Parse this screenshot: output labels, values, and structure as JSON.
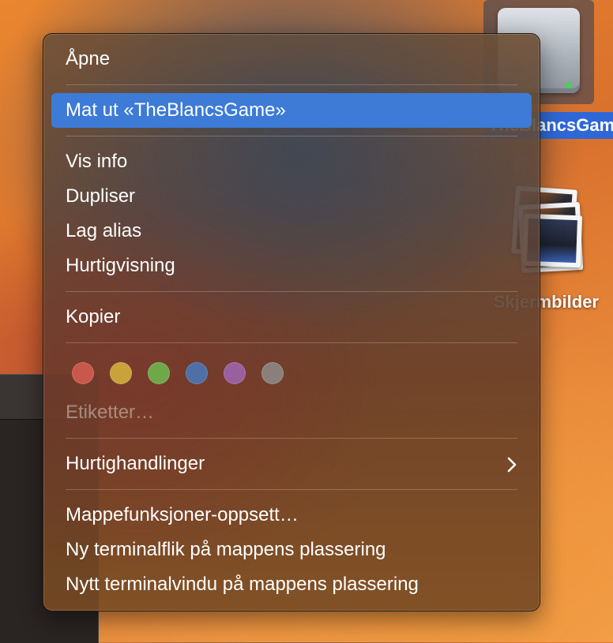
{
  "desktop": {
    "drive_label": "TheBlancsGame",
    "photos_label": "Skjermbilder"
  },
  "menu": {
    "open": "Åpne",
    "eject": "Mat ut «TheBlancsGame»",
    "get_info": "Vis info",
    "duplicate": "Dupliser",
    "make_alias": "Lag alias",
    "quick_look": "Hurtigvisning",
    "copy": "Kopier",
    "tags_label": "Etiketter…",
    "quick_actions": "Hurtighandlinger",
    "folder_actions": "Mappefunksjoner-oppsett…",
    "new_terminal_tab": "Ny terminalflik på mappens plassering",
    "new_terminal_window": "Nytt terminalvindu på mappens plassering"
  },
  "tags": [
    {
      "name": "red",
      "color": "#c9574b"
    },
    {
      "name": "yellow",
      "color": "#c9a23a"
    },
    {
      "name": "green",
      "color": "#6ea84a"
    },
    {
      "name": "blue",
      "color": "#4f6fa6"
    },
    {
      "name": "purple",
      "color": "#9a5f9e"
    },
    {
      "name": "gray",
      "color": "#8a807b"
    }
  ],
  "icons": {
    "submenu": "chevron-right-icon",
    "drive": "external-drive-icon",
    "photos": "photos-folder-icon"
  }
}
